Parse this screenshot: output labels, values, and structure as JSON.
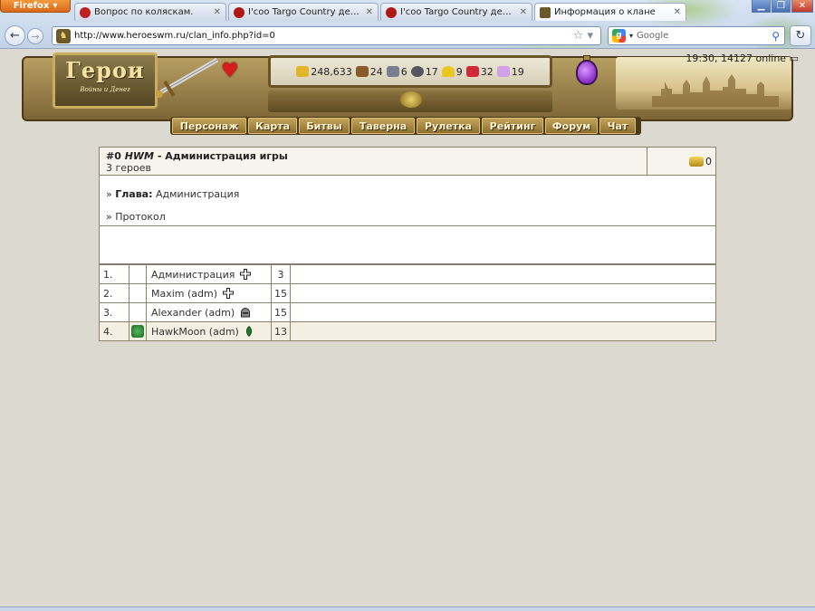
{
  "browser": {
    "app_button": "Firefox",
    "tabs": [
      {
        "label": "Вопрос по коляскам.",
        "icon_color": "#c02020",
        "active": false
      },
      {
        "label": "I'coo Targo Country детская...",
        "icon_color": "#b01818",
        "active": false
      },
      {
        "label": "I'coo Targo Country детская...",
        "icon_color": "#b01818",
        "active": false
      },
      {
        "label": "Информация о клане",
        "icon_color": "#6b5a2a",
        "active": true
      }
    ],
    "url": "http://www.heroeswm.ru/clan_info.php?id=0",
    "search_placeholder": "Google"
  },
  "game": {
    "logo_title": "Герои",
    "logo_subtitle": "Войны и Денег",
    "time_online": "19:30, 14127 online",
    "resources": [
      {
        "name": "gold",
        "value": "248,633",
        "color": "#e2b52a"
      },
      {
        "name": "wood",
        "value": "24",
        "color": "#8a5a2a"
      },
      {
        "name": "ore",
        "value": "6",
        "color": "#7b8090"
      },
      {
        "name": "mercury",
        "value": "17",
        "color": "#555560"
      },
      {
        "name": "sulfur",
        "value": "9",
        "color": "#e8c820"
      },
      {
        "name": "crystals",
        "value": "32",
        "color": "#d02a3a"
      },
      {
        "name": "gems",
        "value": "19",
        "color": "#d0a0e8"
      }
    ],
    "menu": [
      "Персонаж",
      "Карта",
      "Битвы",
      "Таверна",
      "Рулетка",
      "Рейтинг",
      "Форум",
      "Чат"
    ]
  },
  "clan": {
    "number": "#0",
    "tag": "HWM",
    "name": "- Администрация игры",
    "member_count": "3 героев",
    "gold": "0",
    "head_label": "Глава:",
    "head_value": "Администрация",
    "protocol_label": "Протокол",
    "members": [
      {
        "num": "1.",
        "name": "Администрация",
        "faction": "cross",
        "level": "3",
        "avatar": false
      },
      {
        "num": "2.",
        "name": "Maxim (adm)",
        "faction": "cross",
        "level": "15",
        "avatar": false
      },
      {
        "num": "3.",
        "name": "Alexander (adm)",
        "faction": "helmet",
        "level": "15",
        "avatar": false
      },
      {
        "num": "4.",
        "name": "HawkMoon (adm)",
        "faction": "leaf",
        "level": "13",
        "avatar": true
      }
    ]
  }
}
